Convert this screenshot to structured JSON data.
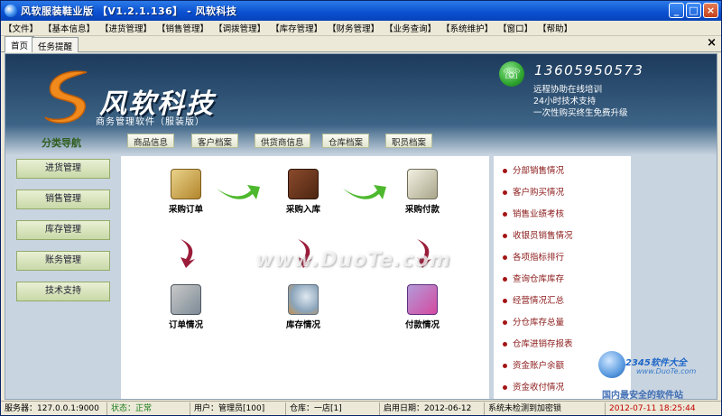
{
  "window": {
    "title": "风软服装鞋业版  【V1.2.1.136】 - 风软科技",
    "minimize": "_",
    "maximize": "□",
    "close": "×"
  },
  "menu": [
    "【文件】",
    "【基本信息】",
    "【进货管理】",
    "【销售管理】",
    "【调拨管理】",
    "【库存管理】",
    "【财务管理】",
    "【业务查询】",
    "【系统维护】",
    "【窗口】",
    "【帮助】"
  ],
  "tabs": [
    "首页",
    "任务提醒"
  ],
  "tab_close": "×",
  "header": {
    "brand": "风软科技",
    "subtitle": "商务管理软件（服装版）",
    "phone": "13605950573",
    "services": [
      "远程协助在线培训",
      "24小时技术支持",
      "一次性购买终生免费升级"
    ]
  },
  "nav": {
    "title": "分类导航",
    "quick": [
      "商品信息",
      "客户档案",
      "供货商信息",
      "仓库档案",
      "职员档案"
    ],
    "left": [
      "进货管理",
      "销售管理",
      "库存管理",
      "账务管理",
      "技术支持"
    ]
  },
  "flow": {
    "top": [
      "采购订单",
      "采购入库",
      "采购付款"
    ],
    "bottom": [
      "订单情况",
      "库存情况",
      "付款情况"
    ]
  },
  "watermark": "www.DuoTe.com",
  "reports": [
    "分部销售情况",
    "客户购买情况",
    "销售业绩考核",
    "收银员销售情况",
    "各项指标排行",
    "查询仓库库存",
    "经营情况汇总",
    "分仓库存总量",
    "仓库进销存报表",
    "资金账户余额",
    "资金收付情况"
  ],
  "corner_watermark": {
    "brand": "2345软件大全",
    "site": "www.DuoTe.com",
    "slogan": "国内最安全的软件站"
  },
  "status": {
    "server": "服务器：127.0.0.1:9000",
    "state": "状态：正常",
    "user": "用户：管理员[100]",
    "warehouse": "仓库：一店[1]",
    "enable_date": "启用日期：2012-06-12",
    "lock": "系统未检测到加密锁",
    "datetime": "2012-07-11  18:25:44"
  },
  "colors": {
    "title_bar": "#0a4fd0",
    "header_dark": "#1c3a5c",
    "report_text": "#8b1a1a",
    "arrow_green": "#4db82d",
    "arrow_maroon": "#9b1d3a"
  }
}
